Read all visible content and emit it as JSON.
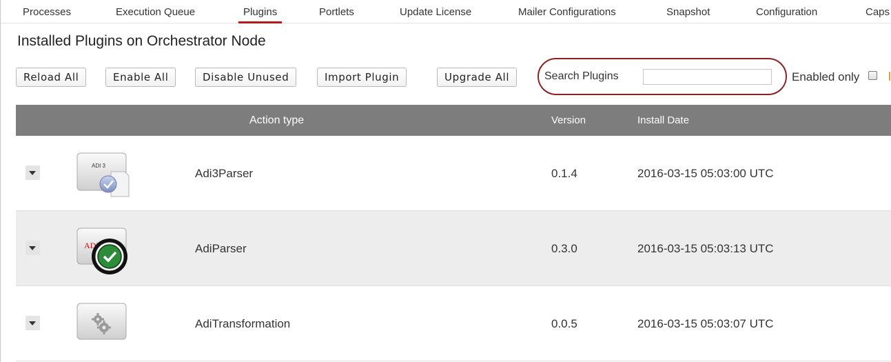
{
  "tabs": [
    {
      "label": "Processes",
      "active": false
    },
    {
      "label": "Execution Queue",
      "active": false
    },
    {
      "label": "Plugins",
      "active": true
    },
    {
      "label": "Portlets",
      "active": false
    },
    {
      "label": "Update License",
      "active": false
    },
    {
      "label": "Mailer Configurations",
      "active": false
    },
    {
      "label": "Snapshot",
      "active": false
    },
    {
      "label": "Configuration",
      "active": false
    },
    {
      "label": "Caps",
      "active": false
    }
  ],
  "page_title": "Installed Plugins on Orchestrator Node",
  "toolbar": {
    "reload_all": "Reload All",
    "enable_all": "Enable All",
    "disable_unused": "Disable Unused",
    "import_plugin": "Import Plugin",
    "upgrade_all": "Upgrade All"
  },
  "search": {
    "label": "Search Plugins",
    "value": "",
    "placeholder": ""
  },
  "filter": {
    "enabled_only_label": "Enabled only",
    "enabled_only_checked": false
  },
  "table": {
    "headers": {
      "action_type": "Action type",
      "version": "Version",
      "install_date": "Install Date"
    },
    "rows": [
      {
        "name": "Adi3Parser",
        "version": "0.1.4",
        "install_date": "2016-03-15 05:03:00 UTC",
        "icon": "adi3-document-check-icon",
        "icon_text": "ADI 3"
      },
      {
        "name": "AdiParser",
        "version": "0.3.0",
        "install_date": "2016-03-15 05:03:13 UTC",
        "icon": "adi-green-check-icon",
        "icon_text": "ADI"
      },
      {
        "name": "AdiTransformation",
        "version": "0.0.5",
        "install_date": "2016-03-15 05:03:07 UTC",
        "icon": "gears-icon",
        "icon_text": ""
      }
    ]
  },
  "colors": {
    "active_tab_underline": "#b31b1b",
    "search_highlight": "#8c2020",
    "table_header_bg": "#7d7d7d",
    "alt_row_bg": "#ededed",
    "check_green": "#2e8b3a"
  }
}
